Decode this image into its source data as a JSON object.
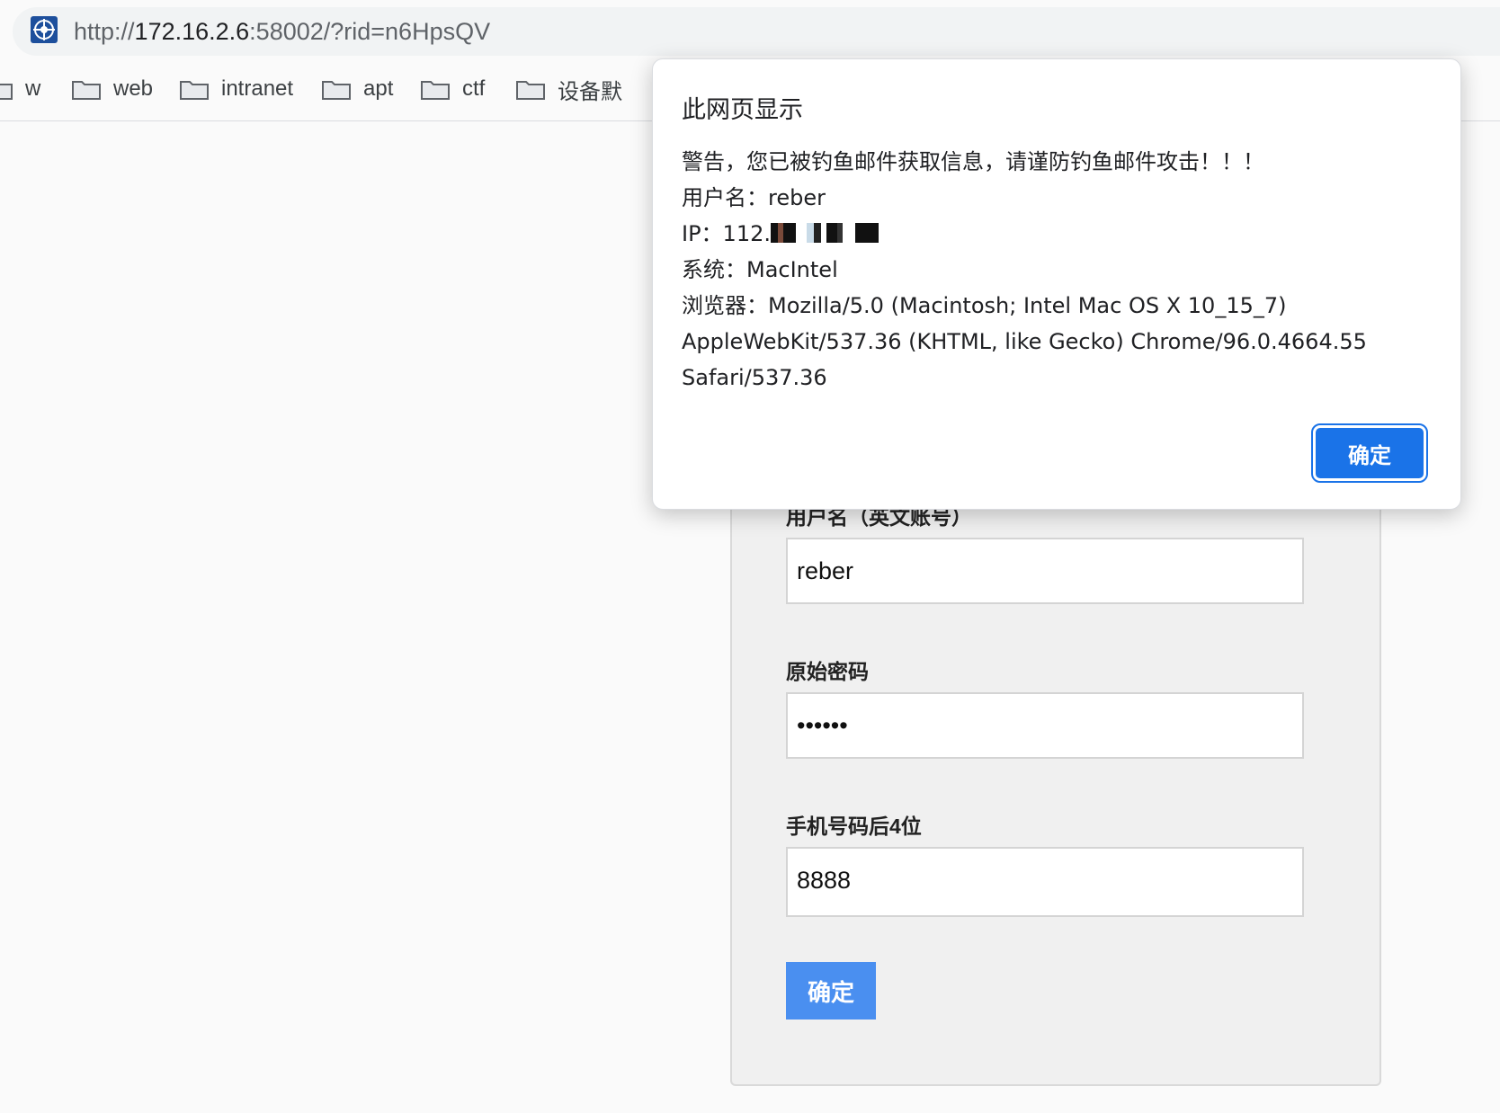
{
  "browser": {
    "url_scheme": "http://",
    "url_host": "172.16.2.6",
    "url_rest": ":58002/?rid=n6HpsQV",
    "bookmarks": [
      "w",
      "web",
      "intranet",
      "apt",
      "ctf",
      "设备默"
    ]
  },
  "form": {
    "username_label": "用户名（英文账号）",
    "username_value": "reber",
    "password_label": "原始密码",
    "password_value": "••••••",
    "phone_label": "手机号码后4位",
    "phone_value": "8888",
    "submit_label": "确定"
  },
  "dialog": {
    "title": "此网页显示",
    "warning": "警告，您已被钓鱼邮件获取信息，请谨防钓鱼邮件攻击！！！",
    "user_line": "用户名：reber",
    "ip_prefix": "IP：112.",
    "system_line": "系统：MacIntel",
    "browser_line1": "浏览器：Mozilla/5.0 (Macintosh; Intel Mac OS X 10_15_7)",
    "browser_line2": "AppleWebKit/537.36 (KHTML, like Gecko) Chrome/96.0.4664.55",
    "browser_line3": "Safari/537.36",
    "ok_label": "确定"
  }
}
